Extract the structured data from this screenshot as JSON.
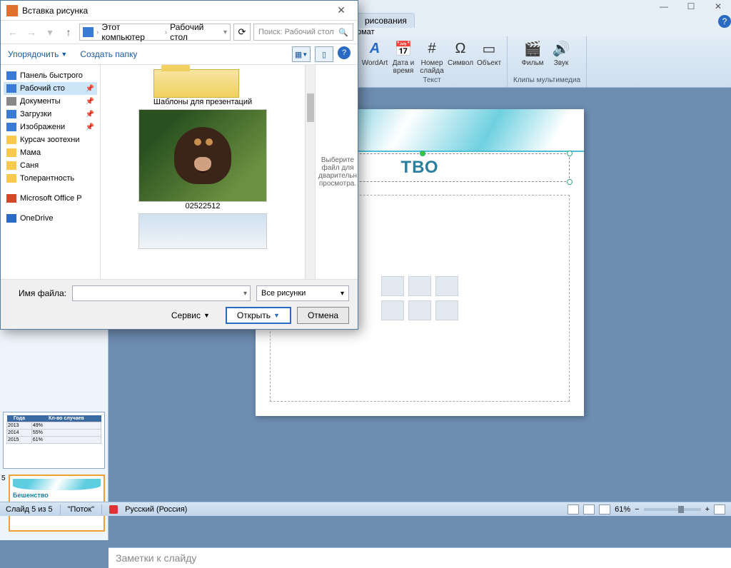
{
  "pp": {
    "title_tab": "рисования",
    "format_tab": "рмат",
    "ribbon": {
      "wordart": "WordArt",
      "date": "Дата и время",
      "number": "Номер слайда",
      "symbol": "Символ",
      "object": "Объект",
      "text_group": "Текст",
      "movie": "Фильм",
      "sound": "Звук",
      "media_group": "Клипы мультимедиа"
    },
    "slide_text": "ТВО",
    "notes": "Заметки к слайду",
    "thumb_title": "Бешенство",
    "thumb_num": "5",
    "table": {
      "h1": "Года",
      "h2": "Кл-во случаев",
      "r1a": "2013",
      "r1b": "49%",
      "r2a": "2014",
      "r2b": "55%",
      "r3a": "2015",
      "r3b": "61%"
    },
    "status": {
      "slide": "Слайд 5 из 5",
      "theme": "\"Поток\"",
      "lang": "Русский (Россия)",
      "zoom": "61%"
    }
  },
  "dlg": {
    "title": "Вставка рисунка",
    "crumb1": "Этот компьютер",
    "crumb2": "Рабочий стол",
    "search_ph": "Поиск: Рабочий стол",
    "organize": "Упорядочить",
    "new_folder": "Создать папку",
    "tree": {
      "quick": "Панель быстрого",
      "desktop": "Рабочий сто",
      "docs": "Документы",
      "downloads": "Загрузки",
      "images": "Изображени",
      "kursach": "Курсач зоотехни",
      "mama": "Мама",
      "sanya": "Саня",
      "toler": "Толерантность",
      "mso": "Microsoft Office P",
      "onedrive": "OneDrive"
    },
    "files": {
      "templates": "Шаблоны для презентаций",
      "dog": "02522512"
    },
    "preview": "Выберите файл для дварительн просмотра.",
    "footer": {
      "fn_label": "Имя файла:",
      "filter": "Все рисунки",
      "service": "Сервис",
      "open": "Открыть",
      "cancel": "Отмена"
    }
  }
}
